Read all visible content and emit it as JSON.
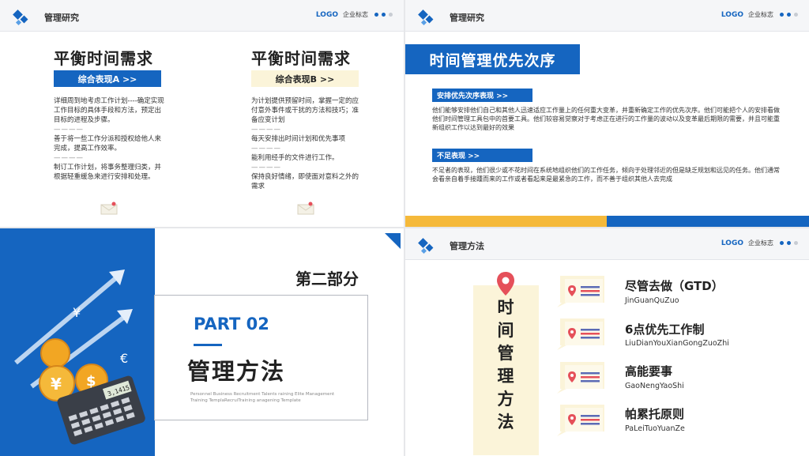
{
  "header": {
    "logo_text": "LOGO",
    "logo_sub": "企业标志"
  },
  "slide1": {
    "header_title": "管理研究",
    "col_a": {
      "title": "平衡时间需求",
      "tag": "综合表现A >>",
      "p1": "详细周到地考虑工作计划----确定实现工作目标的具体手段和方法，预定出目标的进程及步骤。",
      "sep": "————",
      "p2": "善于将一些工作分派和授权给他人来完成，提高工作效率。",
      "p3": "制订工作计划，将事务整理归类，并根据轻重缓急来进行安排和处理。"
    },
    "col_b": {
      "title": "平衡时间需求",
      "tag": "综合表现B >>",
      "p1": "为计划提供预留时间，掌握一定的应付意外事件或干扰的方法和技巧；准备应变计划",
      "sep": "————",
      "p2": "每天安排出时间计划和优先事项",
      "p3": "能利用经手的文件进行工作。",
      "p4": "保持良好情绪，即使面对意料之外的需求"
    }
  },
  "slide2": {
    "header_title": "",
    "title": "时间管理优先次序",
    "tag1": "安排优先次序表现 >>",
    "para1": "他们能够安排他们自己和其他人迅速适应工作量上的任何重大变革，并重新确定工作的优先次序。他们可能把个人的安排看做他们时间管理工具包中的首要工具。他们较容易觉察对于考虑正在进行的工作量的波动以及变革最后期限的需要，并且可能重新组织工作以达到最好的效果",
    "tag2": "不足表现 >>",
    "para2": "不足者的表现，他们很少或不花时间在系统地组织他们的工作任务，倾向于处理邻近的但是缺乏规划和远见的任务。他们通常会看亲自着手接踵而来的工作或者看起来是最紧急的工作，而不善于组织其他人去完成",
    "bar_colors": [
      "#f5b93a",
      "#1565c0"
    ]
  },
  "slide3": {
    "section": "第二部分",
    "part": "PART 02",
    "title": "管理方法",
    "en_text": "Personnel Business Recruitment Talents raining Elite Management Training TemplaRecruiTraining anagening Template",
    "yen_symbol": "¥",
    "euro_symbol": "€",
    "calc_display": "3,1415"
  },
  "slide4": {
    "header_title": "管理方法",
    "vertical_title": [
      "时",
      "间",
      "管",
      "理",
      "方",
      "法"
    ],
    "items": [
      {
        "title": "尽管去做（GTD）",
        "sub": "JinGuanQuZuo"
      },
      {
        "title": "6点优先工作制",
        "sub": "LiuDianYouXianGongZuoZhi"
      },
      {
        "title": "高能要事",
        "sub": "GaoNengYaoShi"
      },
      {
        "title": "帕累托原则",
        "sub": "PaLeiTuoYuanZe"
      }
    ]
  },
  "colors": {
    "brand_blue": "#1565c0",
    "tag_b_bg": "#fbf4d9",
    "pin_red": "#e5505a",
    "accent_yellow": "#f5b93a"
  }
}
